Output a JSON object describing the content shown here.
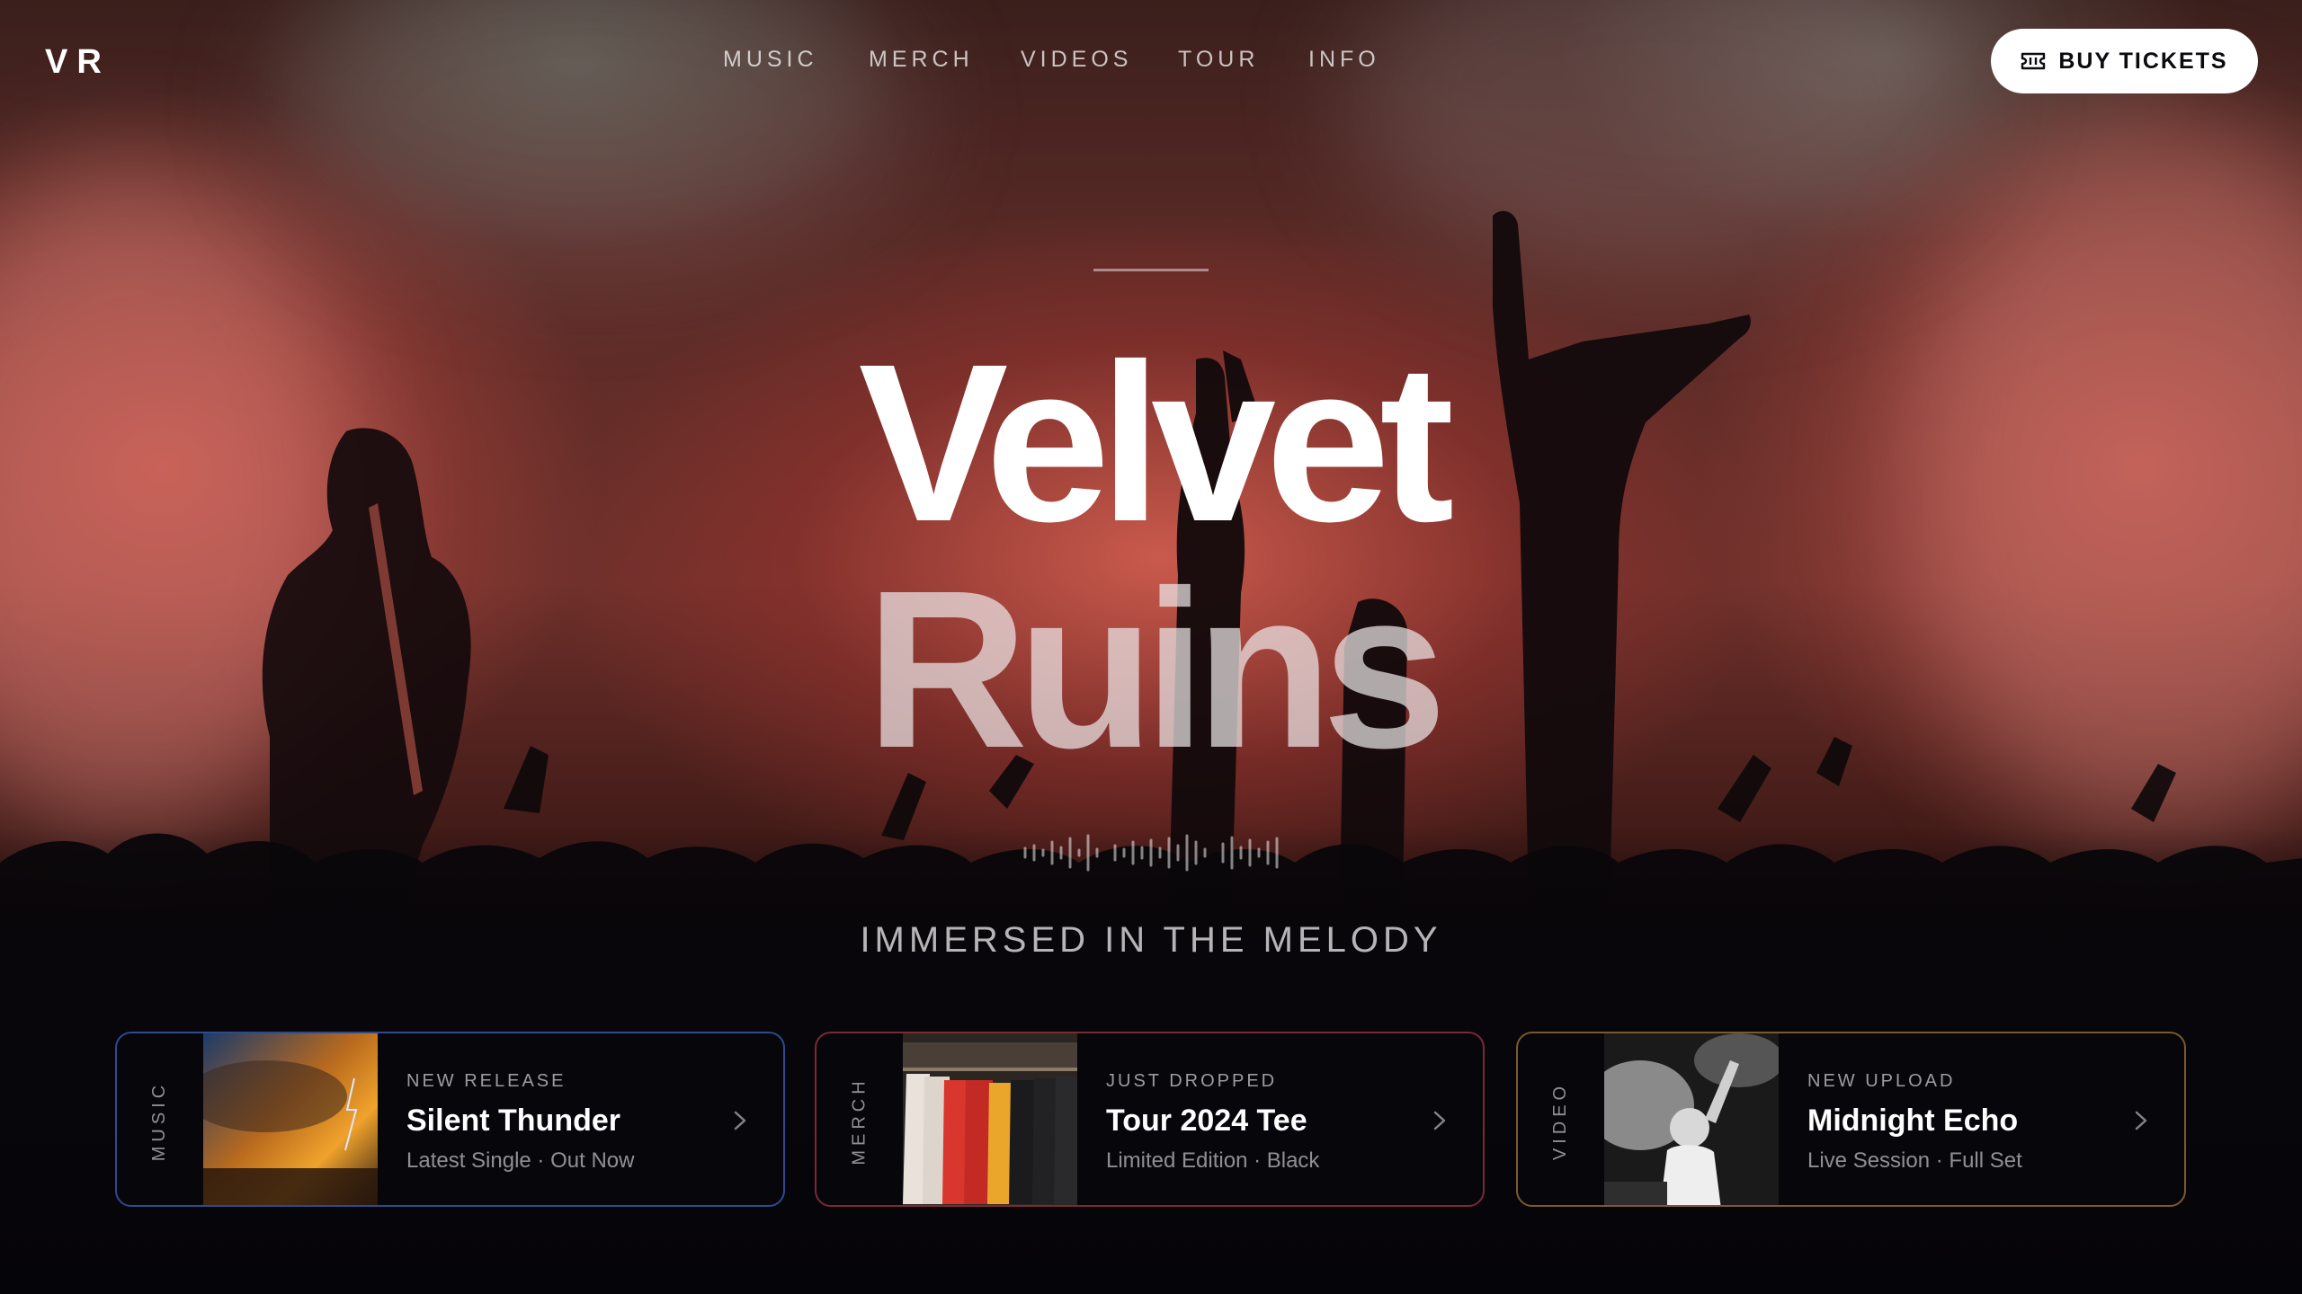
{
  "brand": {
    "logo": "VR"
  },
  "nav": {
    "items": [
      "MUSIC",
      "MERCH",
      "VIDEOS",
      "TOUR",
      "INFO"
    ],
    "cta_label": "BUY TICKETS",
    "cta_icon": "ticket-icon"
  },
  "hero": {
    "title_line1": "Velvet",
    "title_line2": "Ruins",
    "tagline": "IMMERSED IN THE MELODY",
    "accent_colors": {
      "stage_red": "#c85a4e",
      "background": "#07060a"
    }
  },
  "cards": [
    {
      "side_label": "MUSIC",
      "eyebrow": "NEW RELEASE",
      "title": "Silent Thunder",
      "subtitle": "Latest Single · Out Now",
      "border_color": "#2e4a8e",
      "icon": "chevron-right-icon"
    },
    {
      "side_label": "MERCH",
      "eyebrow": "JUST DROPPED",
      "title": "Tour 2024 Tee",
      "subtitle": "Limited Edition · Black",
      "border_color": "#7a2a34",
      "icon": "chevron-right-icon"
    },
    {
      "side_label": "VIDEO",
      "eyebrow": "NEW UPLOAD",
      "title": "Midnight Echo",
      "subtitle": "Live Session · Full Set",
      "border_color": "#7a5a2a",
      "icon": "chevron-right-icon"
    }
  ]
}
